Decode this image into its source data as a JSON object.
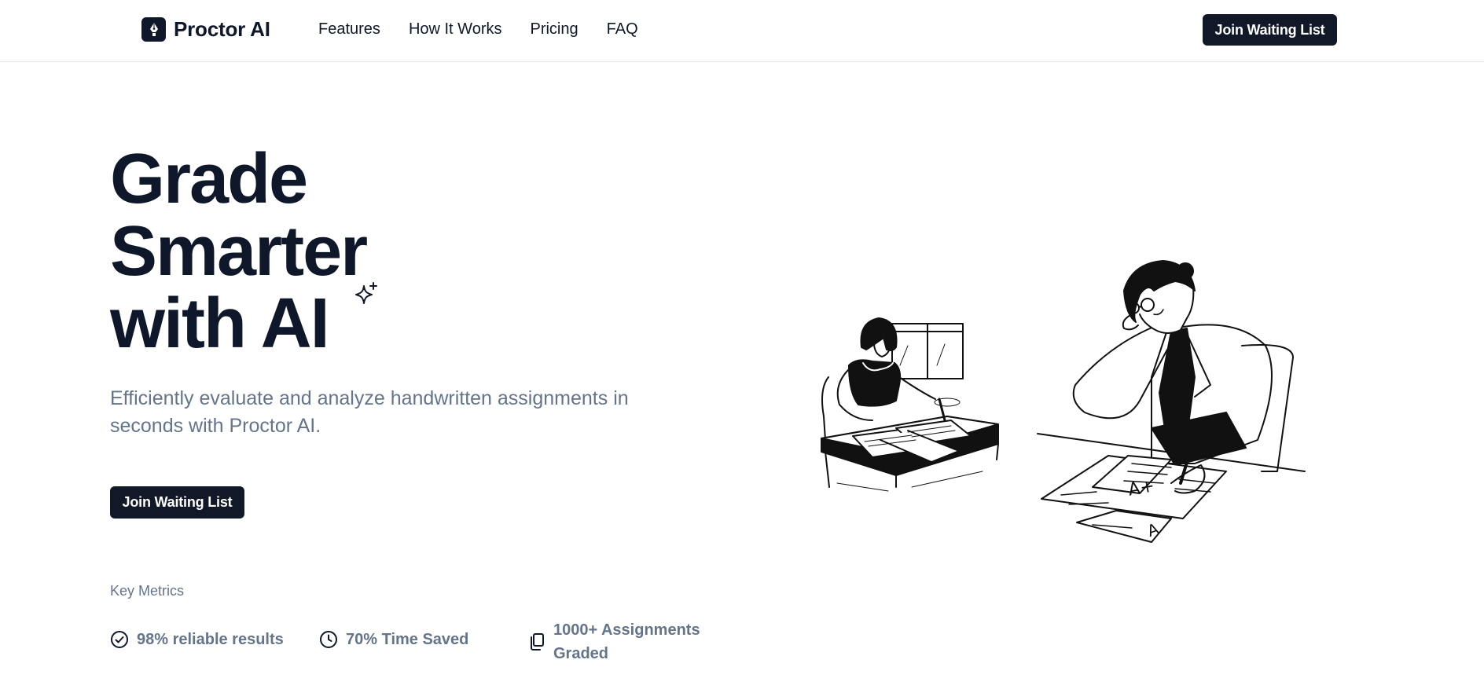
{
  "header": {
    "brand": "Proctor AI",
    "nav": [
      "Features",
      "How It Works",
      "Pricing",
      "FAQ"
    ],
    "cta_label": "Join Waiting List"
  },
  "hero": {
    "title_lines": [
      "Grade",
      "Smarter",
      "with AI"
    ],
    "subtitle": "Efficiently evaluate and analyze handwritten assignments in seconds with Proctor AI.",
    "cta_label": "Join Waiting List",
    "sparkle_icon": "sparkle-icon"
  },
  "metrics": {
    "label": "Key Metrics",
    "items": [
      {
        "icon": "check-circle-icon",
        "text": "98% reliable results"
      },
      {
        "icon": "clock-icon",
        "text": "70% Time Saved"
      },
      {
        "icon": "copy-documents-icon",
        "text": "1000+ Assignments Graded"
      }
    ]
  },
  "colors": {
    "primary_dark": "#111827",
    "heading": "#0f172a",
    "muted": "#64748b",
    "border": "#e5e7eb"
  }
}
